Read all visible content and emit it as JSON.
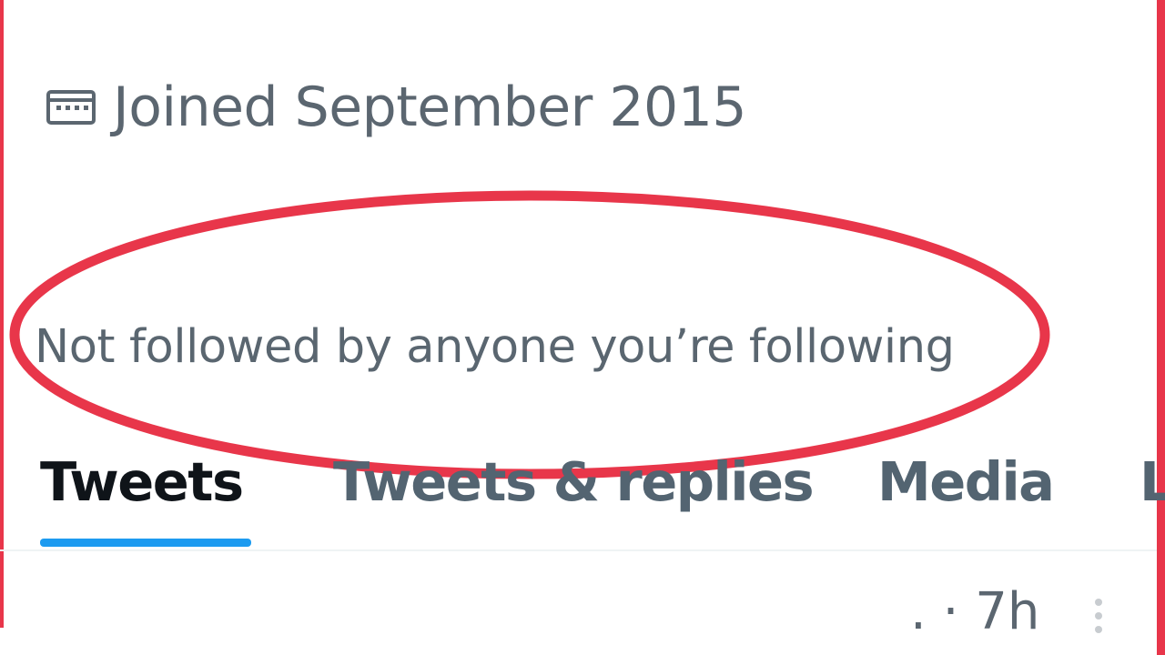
{
  "profile": {
    "joined_text": "Joined September 2015",
    "followers_note": "Not followed by anyone you’re following"
  },
  "tabs": [
    {
      "label": "Tweets",
      "selected": true
    },
    {
      "label": "Tweets & replies",
      "selected": false
    },
    {
      "label": "Media",
      "selected": false
    },
    {
      "label": "L",
      "selected": false
    }
  ],
  "tweet": {
    "separator": ".",
    "timestamp": "· 7h"
  },
  "icons": {
    "calendar": "calendar-icon",
    "more": "more-vertical-icon"
  },
  "colors": {
    "annotation_border": "#e8364a",
    "tab_indicator": "#1d9bf0",
    "secondary_text": "#536471",
    "primary_text": "#0f1419"
  }
}
